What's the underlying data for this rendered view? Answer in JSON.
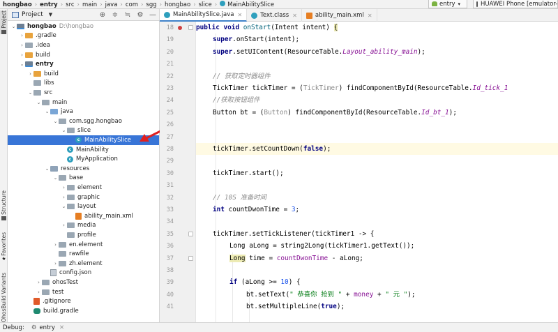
{
  "breadcrumb": [
    "hongbao",
    "entry",
    "src",
    "main",
    "java",
    "com",
    "sgg",
    "hongbao",
    "slice",
    "MainAbilitySlice"
  ],
  "run_config": "entry",
  "device": "HUAWEI Phone [emulator-5",
  "left_strip": [
    "Project",
    "Structure",
    "Favorites",
    "OhosBuild Variants"
  ],
  "project_panel": {
    "title": "Project",
    "tools": [
      "target-icon",
      "collapse-icon",
      "expand-icon",
      "gear-icon",
      "minimize-icon"
    ]
  },
  "tree": [
    {
      "label": "hongbao",
      "extra": "D:\\hongbao",
      "depth": 0,
      "expanded": true,
      "icon": "module",
      "bold": true
    },
    {
      "label": ".gradle",
      "depth": 1,
      "expanded": false,
      "icon": "folder-orange"
    },
    {
      "label": ".idea",
      "depth": 1,
      "expanded": false,
      "icon": "folder"
    },
    {
      "label": "build",
      "depth": 1,
      "expanded": false,
      "icon": "folder-orange"
    },
    {
      "label": "entry",
      "depth": 1,
      "expanded": true,
      "icon": "module",
      "bold": true
    },
    {
      "label": "build",
      "depth": 2,
      "expanded": false,
      "icon": "folder-orange"
    },
    {
      "label": "libs",
      "depth": 2,
      "icon": "folder"
    },
    {
      "label": "src",
      "depth": 2,
      "expanded": true,
      "icon": "folder"
    },
    {
      "label": "main",
      "depth": 3,
      "expanded": true,
      "icon": "folder"
    },
    {
      "label": "java",
      "depth": 4,
      "expanded": true,
      "icon": "folder-blue"
    },
    {
      "label": "com.sgg.hongbao",
      "depth": 5,
      "expanded": true,
      "icon": "folder"
    },
    {
      "label": "slice",
      "depth": 6,
      "expanded": true,
      "icon": "folder"
    },
    {
      "label": "MainAbilitySlice",
      "depth": 7,
      "icon": "class",
      "selected": true
    },
    {
      "label": "MainAbility",
      "depth": 6,
      "icon": "class"
    },
    {
      "label": "MyApplication",
      "depth": 6,
      "icon": "class"
    },
    {
      "label": "resources",
      "depth": 4,
      "expanded": true,
      "icon": "folder-res"
    },
    {
      "label": "base",
      "depth": 5,
      "expanded": true,
      "icon": "folder"
    },
    {
      "label": "element",
      "depth": 6,
      "expanded": false,
      "icon": "folder"
    },
    {
      "label": "graphic",
      "depth": 6,
      "expanded": false,
      "icon": "folder"
    },
    {
      "label": "layout",
      "depth": 6,
      "expanded": true,
      "icon": "folder"
    },
    {
      "label": "ability_main.xml",
      "depth": 7,
      "icon": "xml"
    },
    {
      "label": "media",
      "depth": 6,
      "expanded": false,
      "icon": "folder"
    },
    {
      "label": "profile",
      "depth": 6,
      "icon": "folder"
    },
    {
      "label": "en.element",
      "depth": 5,
      "expanded": false,
      "icon": "folder"
    },
    {
      "label": "rawfile",
      "depth": 5,
      "icon": "folder"
    },
    {
      "label": "zh.element",
      "depth": 5,
      "expanded": false,
      "icon": "folder"
    },
    {
      "label": "config.json",
      "depth": 4,
      "icon": "json"
    },
    {
      "label": "ohosTest",
      "depth": 3,
      "expanded": false,
      "icon": "folder"
    },
    {
      "label": "test",
      "depth": 3,
      "expanded": false,
      "icon": "folder"
    },
    {
      "label": ".gitignore",
      "depth": 2,
      "icon": "git"
    },
    {
      "label": "build.gradle",
      "depth": 2,
      "icon": "gradle"
    }
  ],
  "tabs": [
    {
      "label": "MainAbilitySlice.java",
      "icon": "class-icon",
      "active": true
    },
    {
      "label": "Text.class",
      "icon": "class-icon",
      "active": false
    },
    {
      "label": "ability_main.xml",
      "icon": "xml-icon",
      "active": false
    }
  ],
  "editor": {
    "line_numbers": [
      "18",
      "19",
      "20",
      "21",
      "22",
      "23",
      "24",
      "25",
      "26",
      "27",
      "28",
      "29",
      "30",
      "31",
      "32",
      "33",
      "34",
      "35",
      "36",
      "37",
      "38",
      "39",
      "40",
      "41"
    ],
    "current_line": "27"
  },
  "bottom": {
    "label": "Debug:",
    "config": "entry"
  }
}
